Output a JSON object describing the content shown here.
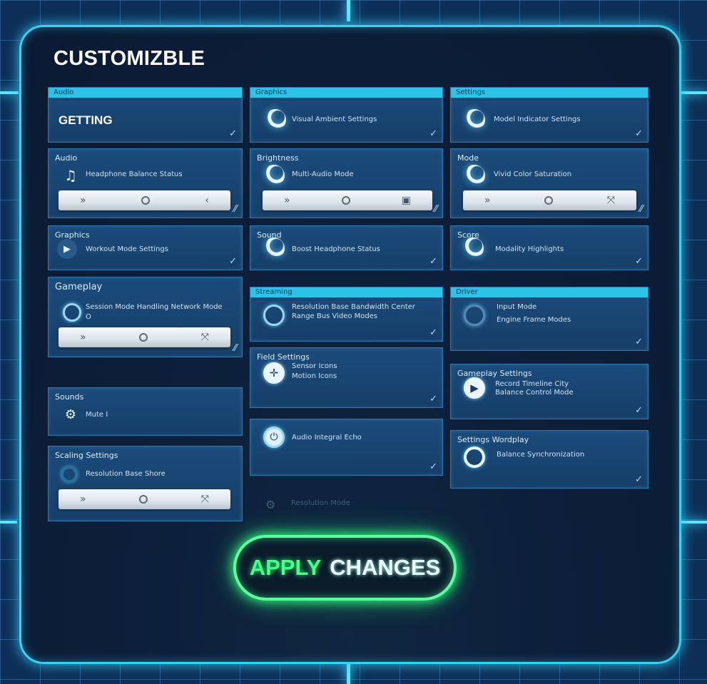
{
  "title": "CUSTOMIZBLE",
  "cards": {
    "c1": {
      "head": "Audio",
      "big": "GETTING"
    },
    "c2": {
      "head": "Graphics",
      "text": "Visual Ambient Settings"
    },
    "c3": {
      "head": "Settings",
      "text": "Model Indicator Settings"
    },
    "c4": {
      "label": "Audio",
      "text": "Headphone Balance Status",
      "slider": {
        "left": "»",
        "right": "‹"
      }
    },
    "c5": {
      "label": "Brightness",
      "text": "Multi-Audio Mode",
      "slider": {
        "left": "»",
        "right": "▣"
      }
    },
    "c6": {
      "label": "Mode",
      "text": "Vivid Color Saturation",
      "slider": {
        "left": "»",
        "right": "⤧"
      }
    },
    "c7": {
      "label": "Graphics",
      "text": "Workout Mode Settings"
    },
    "c8": {
      "label": "Sound",
      "text": "Boost Headphone Status"
    },
    "c9": {
      "label": "Score",
      "text": "Modality Highlights"
    },
    "c10": {
      "label": "Gameplay",
      "text": "Session Mode Handling Network Mode",
      "sub": "O",
      "slider": {
        "left": "»",
        "right": "⤧"
      }
    },
    "c11": {
      "head": "Streaming",
      "text": "Resolution Base Bandwidth Center",
      "text2": "Range Bus Video Modes"
    },
    "c12": {
      "head": "Driver",
      "text": "Input Mode",
      "text2": "Engine Frame Modes"
    },
    "c13": {
      "label": "Field Settings",
      "text": "Sensor Icons",
      "text2": "Motion Icons"
    },
    "c14": {
      "label": "Sounds",
      "text": "Mute I"
    },
    "c15": {
      "label": "Gameplay Settings",
      "text": "Record Timeline City",
      "text2": "Balance Control Mode"
    },
    "c16": {
      "label": "Settings  Wordplay",
      "text": "Balance Synchronization"
    },
    "c17": {
      "label": "Scaling Settings",
      "text": "Resolution Base Shore",
      "slider": {
        "left": "»",
        "right": "⤧"
      }
    },
    "c18": {
      "text": "Audio Integral Echo"
    }
  },
  "ghost_text": "Resolution Mode",
  "apply": {
    "word1": "APPLY",
    "word2": "CHANGES"
  },
  "colors": {
    "accent": "#2bc4e6",
    "panel_border": "#37d2f4",
    "apply_green": "#49ff86"
  }
}
